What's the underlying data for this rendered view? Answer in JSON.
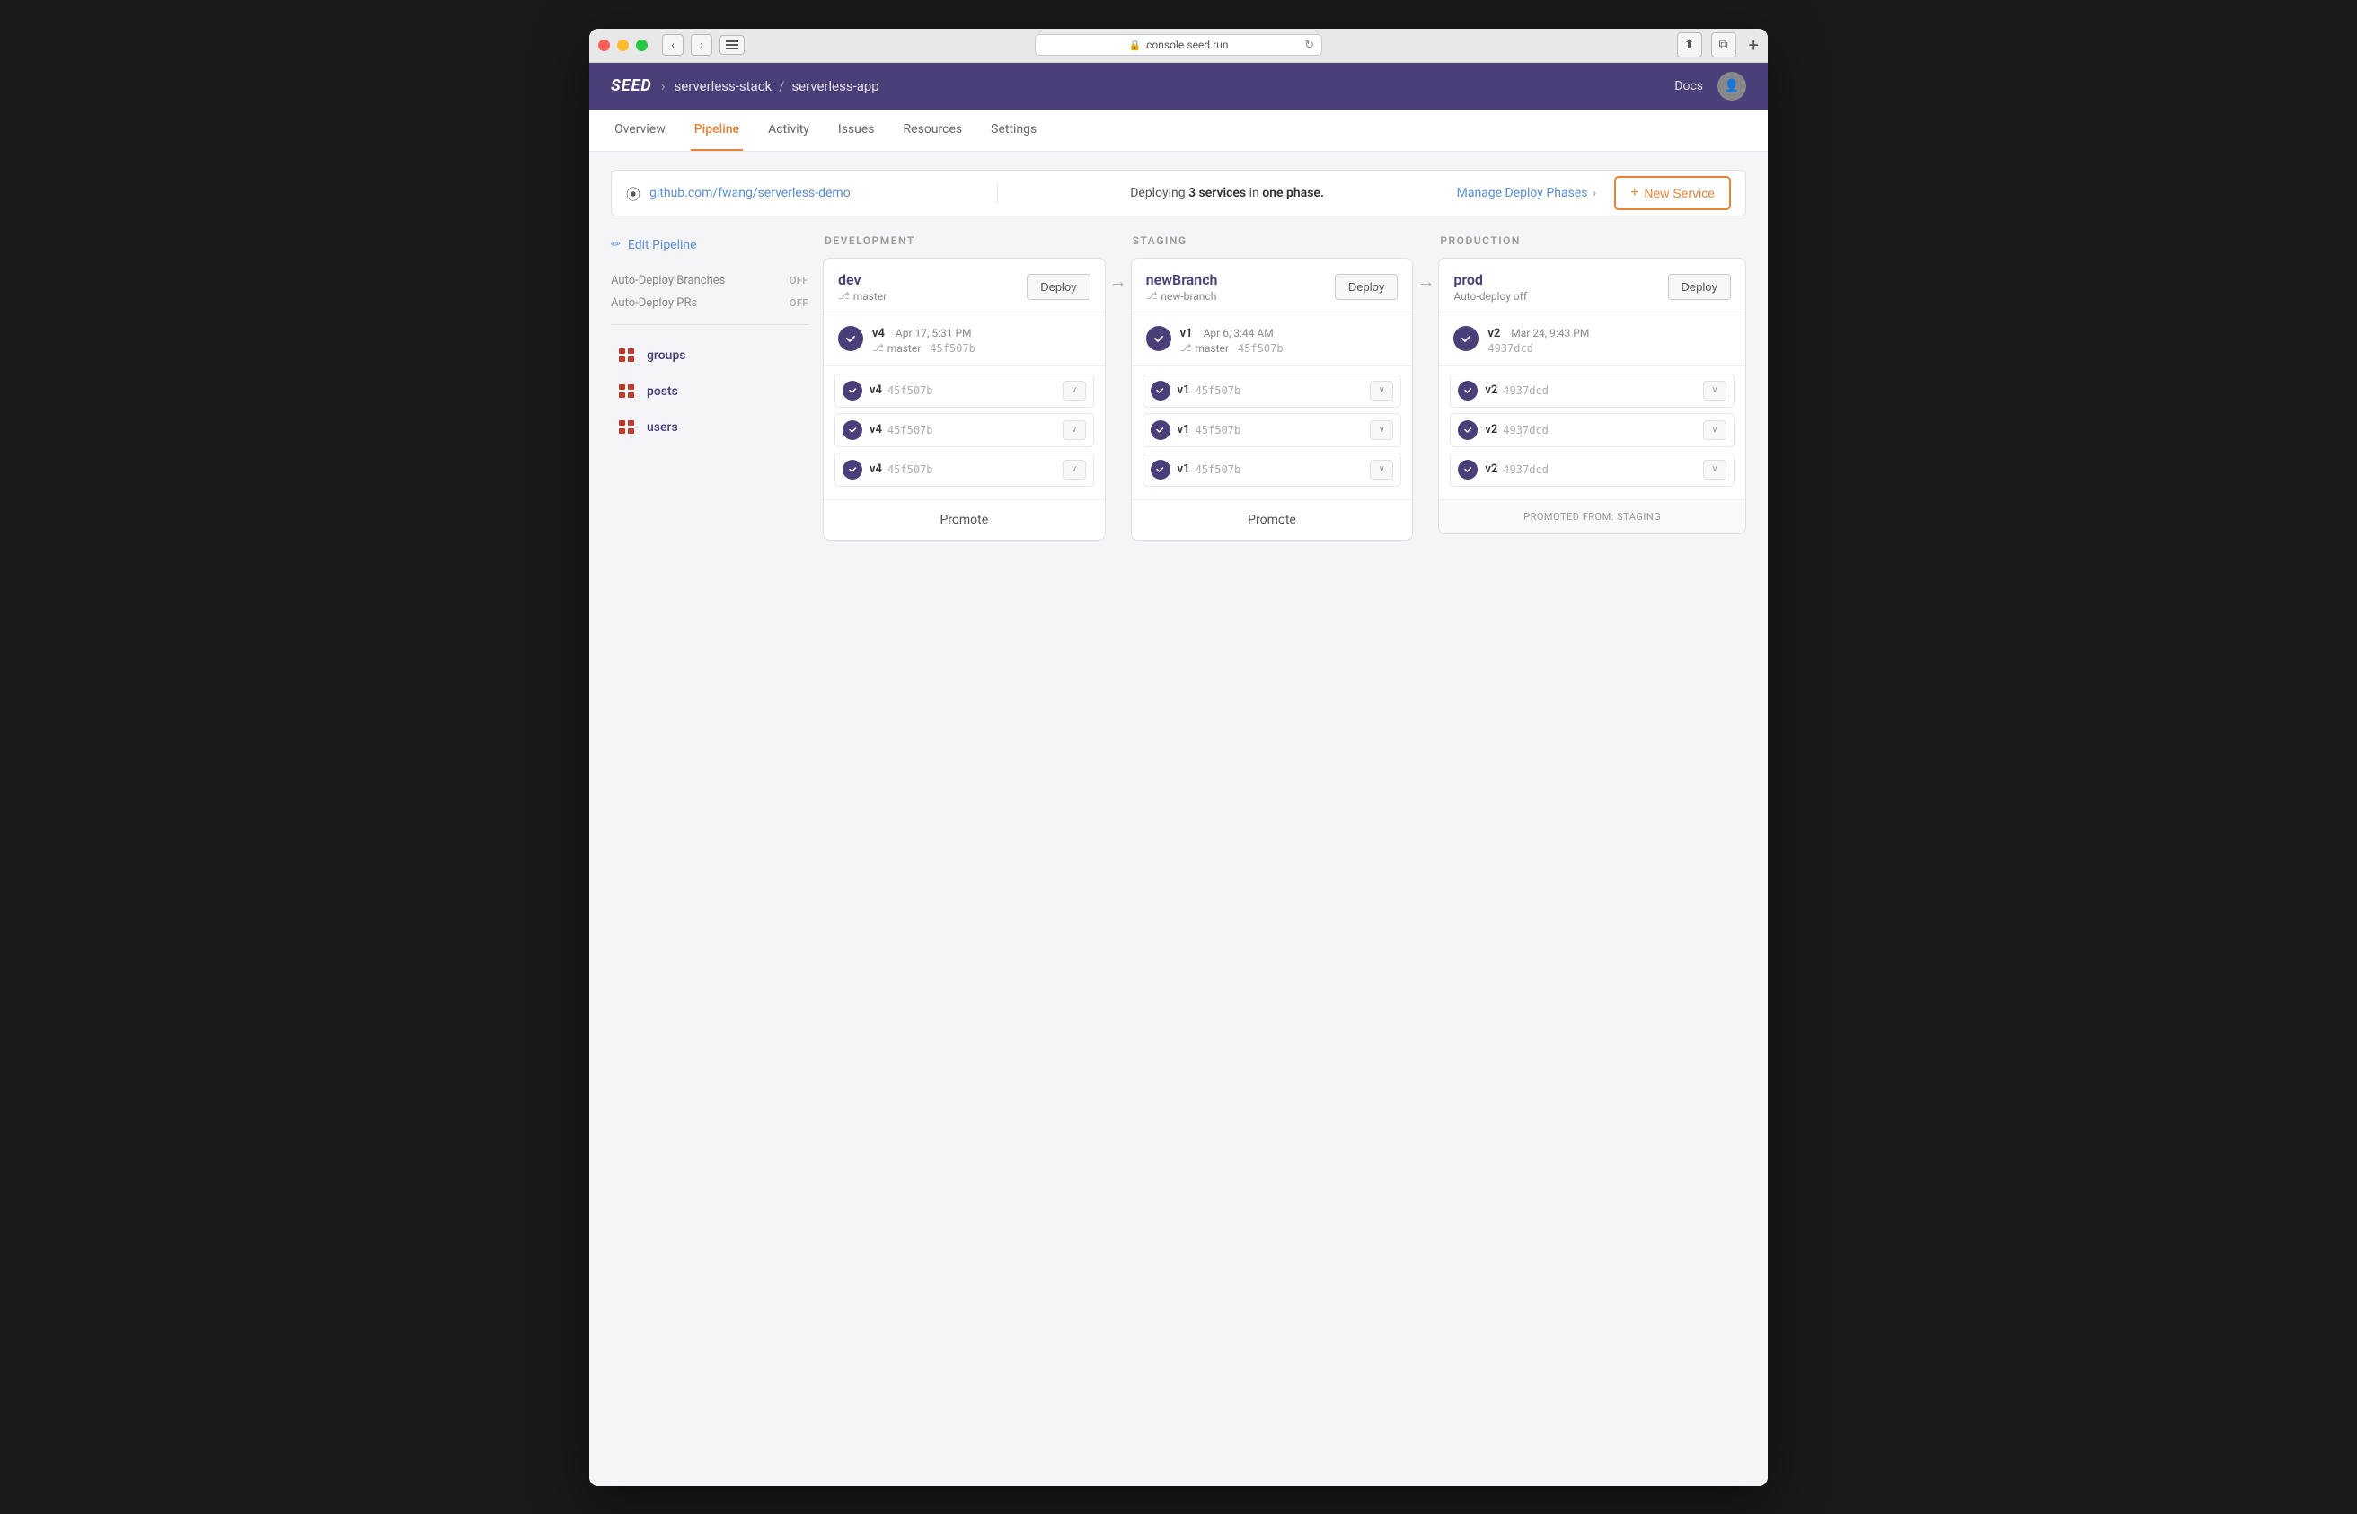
{
  "window": {
    "url": "console.seed.run"
  },
  "app_header": {
    "logo": "SEED",
    "breadcrumb": [
      {
        "label": "serverless-stack"
      },
      {
        "label": "serverless-app"
      }
    ],
    "docs_label": "Docs"
  },
  "nav": {
    "tabs": [
      {
        "label": "Overview",
        "active": false
      },
      {
        "label": "Pipeline",
        "active": true
      },
      {
        "label": "Activity",
        "active": false
      },
      {
        "label": "Issues",
        "active": false
      },
      {
        "label": "Resources",
        "active": false
      },
      {
        "label": "Settings",
        "active": false
      }
    ]
  },
  "info_bar": {
    "repo": "github.com/fwang/serverless-demo",
    "deploying_text": "Deploying",
    "services_count": "3 services",
    "in_text": "in",
    "phase_text": "one phase.",
    "manage_label": "Manage Deploy Phases",
    "new_service_label": "New Service",
    "plus": "+"
  },
  "sidebar": {
    "edit_pipeline_label": "Edit Pipeline",
    "settings": [
      {
        "label": "Auto-Deploy Branches",
        "value": "OFF"
      },
      {
        "label": "Auto-Deploy PRs",
        "value": "OFF"
      }
    ],
    "services": [
      {
        "name": "groups"
      },
      {
        "name": "posts"
      },
      {
        "name": "users"
      }
    ]
  },
  "stages": [
    {
      "id": "development",
      "header": "DEVELOPMENT",
      "env_name": "dev",
      "branch": "master",
      "auto_deploy": null,
      "latest": {
        "version": "v4",
        "time": "Apr 17, 5:31 PM",
        "branch": "master",
        "hash": "45f507b"
      },
      "services": [
        {
          "version": "v4",
          "hash": "45f507b"
        },
        {
          "version": "v4",
          "hash": "45f507b"
        },
        {
          "version": "v4",
          "hash": "45f507b"
        }
      ],
      "footer": "Promote",
      "footer_type": "promote"
    },
    {
      "id": "staging",
      "header": "STAGING",
      "env_name": "newBranch",
      "branch": "new-branch",
      "auto_deploy": null,
      "latest": {
        "version": "v1",
        "time": "Apr 6, 3:44 AM",
        "branch": "master",
        "hash": "45f507b"
      },
      "services": [
        {
          "version": "v1",
          "hash": "45f507b"
        },
        {
          "version": "v1",
          "hash": "45f507b"
        },
        {
          "version": "v1",
          "hash": "45f507b"
        }
      ],
      "footer": "Promote",
      "footer_type": "promote"
    },
    {
      "id": "production",
      "header": "PRODUCTION",
      "env_name": "prod",
      "branch": null,
      "auto_deploy": "Auto-deploy off",
      "latest": {
        "version": "v2",
        "time": "Mar 24, 9:43 PM",
        "branch": null,
        "hash": "4937dcd"
      },
      "services": [
        {
          "version": "v2",
          "hash": "4937dcd"
        },
        {
          "version": "v2",
          "hash": "4937dcd"
        },
        {
          "version": "v2",
          "hash": "4937dcd"
        }
      ],
      "footer": "PROMOTED FROM: staging",
      "footer_type": "promoted"
    }
  ]
}
